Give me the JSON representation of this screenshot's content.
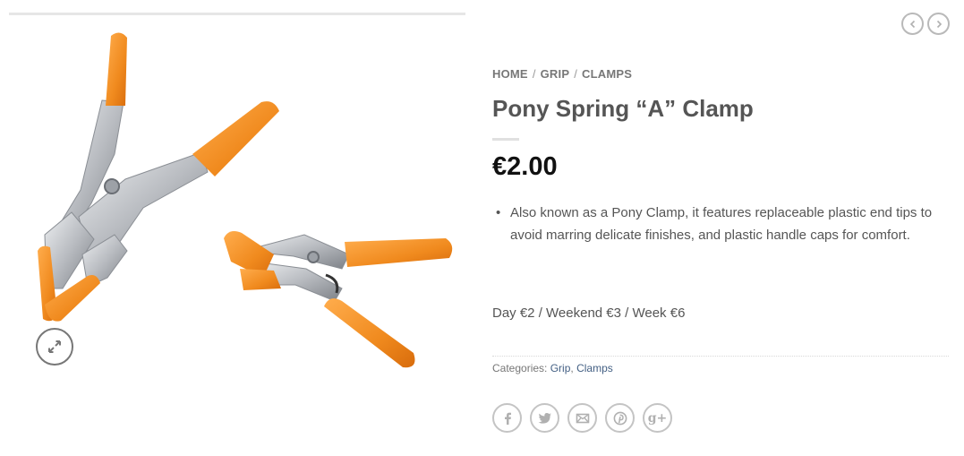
{
  "breadcrumb": {
    "home": "HOME",
    "grip": "GRIP",
    "clamps": "CLAMPS",
    "separator": "/"
  },
  "product": {
    "title": "Pony Spring “A” Clamp",
    "price": "€2.00",
    "description": "Also known as a Pony Clamp, it features replaceable plastic end tips to avoid marring delicate finishes, and plastic handle caps for comfort.",
    "rates": "Day €2 / Weekend €3 / Week €6"
  },
  "meta": {
    "categories_label": "Categories:",
    "category_1": "Grip",
    "category_separator": ",",
    "category_2": "Clamps"
  },
  "icons": {
    "zoom": "expand-icon",
    "prev": "chevron-left-icon",
    "next": "chevron-right-icon",
    "share": [
      "facebook-icon",
      "twitter-icon",
      "email-icon",
      "pinterest-icon",
      "google-plus-icon"
    ],
    "google_plus_glyph": "g+"
  },
  "colors": {
    "handle_orange": "#f08a1e",
    "steel": "#c9ccd0",
    "link": "#446084",
    "title": "#555555",
    "price": "#111111"
  }
}
